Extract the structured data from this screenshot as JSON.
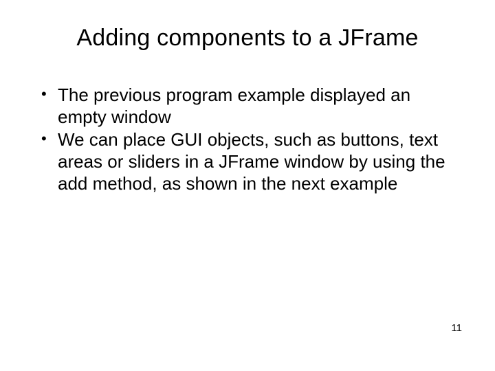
{
  "slide": {
    "title": "Adding components to a JFrame",
    "bullets": [
      "The previous program example displayed an empty window",
      "We can place GUI objects, such as buttons, text areas or sliders in a JFrame window by using the add method, as shown in the next example"
    ],
    "page_number": "11"
  }
}
